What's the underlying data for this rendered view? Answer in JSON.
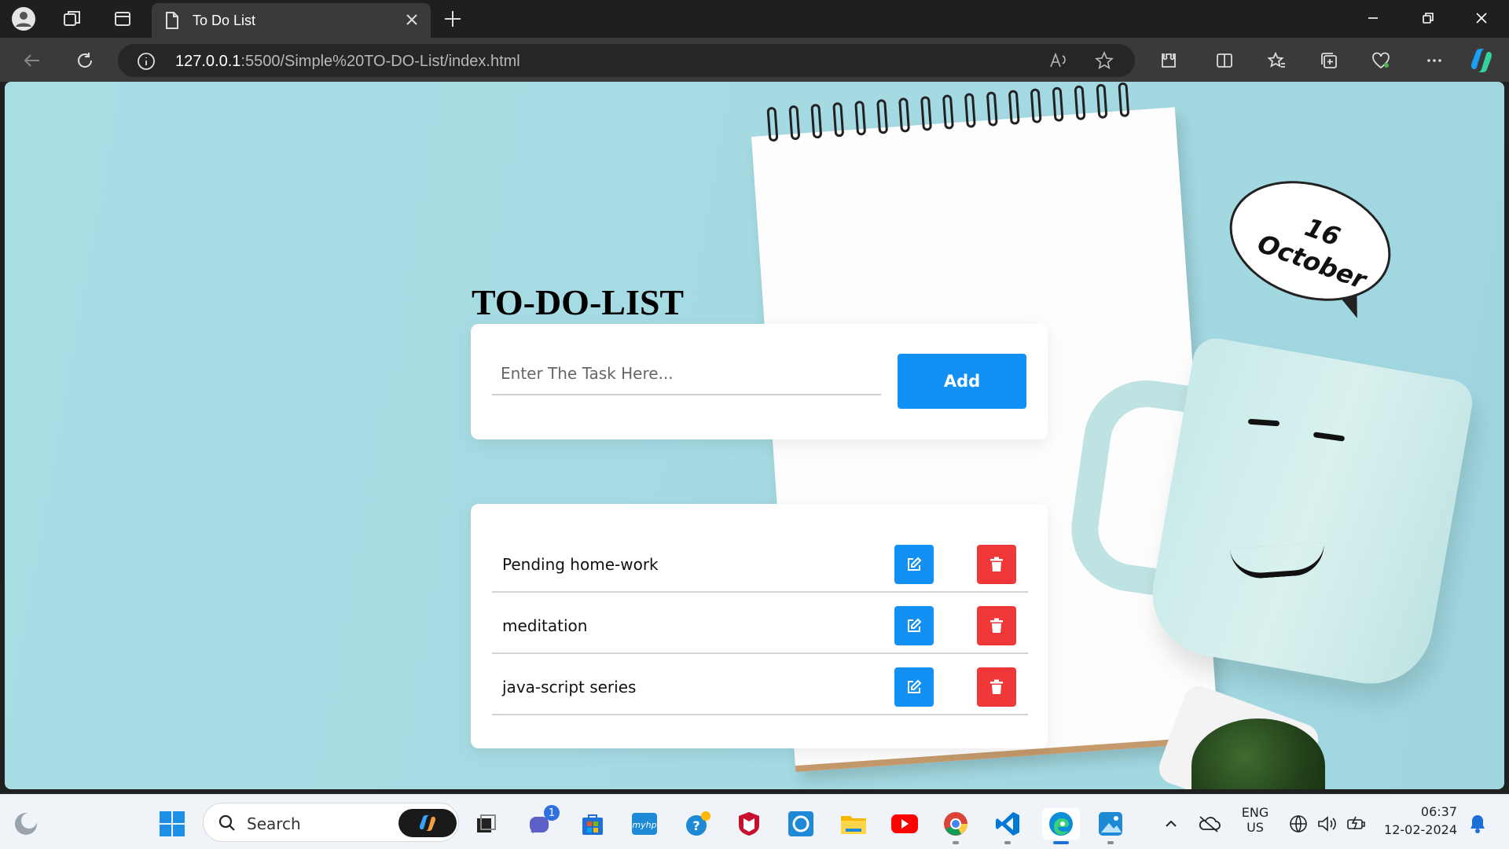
{
  "browser": {
    "tab_title": "To Do List",
    "url_host": "127.0.0.1",
    "url_rest": ":5500/Simple%20TO-DO-List/index.html"
  },
  "page": {
    "title": "TO-DO-LIST",
    "input_placeholder": "Enter The Task Here...",
    "add_label": "Add",
    "tasks": [
      {
        "text": "Pending home-work"
      },
      {
        "text": "meditation"
      },
      {
        "text": "java-script series"
      }
    ],
    "background_text": {
      "day": "16",
      "month": "October"
    }
  },
  "taskbar": {
    "search_label": "Search",
    "teams_badge": "1",
    "lang_top": "ENG",
    "lang_bottom": "US",
    "time": "06:37",
    "date": "12-02-2024"
  },
  "colors": {
    "accent_blue": "#1290f4",
    "delete_red": "#f03838",
    "page_bg": "#a9dde4"
  }
}
